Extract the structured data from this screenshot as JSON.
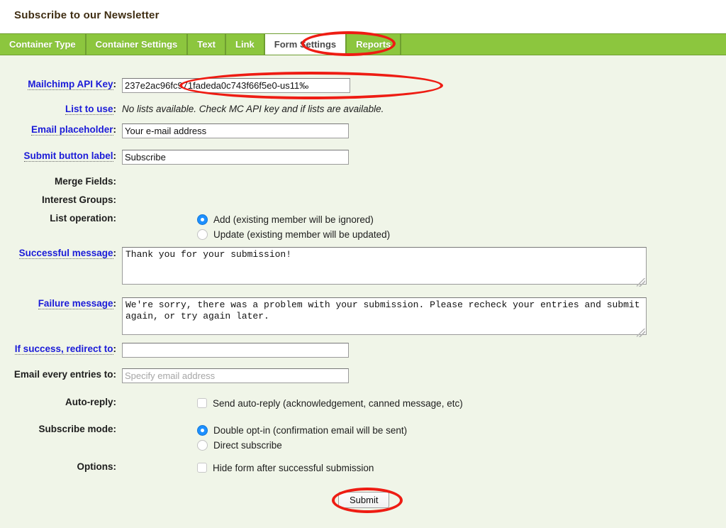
{
  "page": {
    "title": "Subscribe to our Newsletter",
    "background_color": "#f0f5e8",
    "tab_color": "#8cc63e",
    "annotation_color": "#ee1c13",
    "link_color": "#1b1bd8"
  },
  "tabs": [
    {
      "label": "Container Type",
      "active": false
    },
    {
      "label": "Container Settings",
      "active": false
    },
    {
      "label": "Text",
      "active": false
    },
    {
      "label": "Link",
      "active": false
    },
    {
      "label": "Form Settings",
      "active": true
    },
    {
      "label": "Reports",
      "active": false
    }
  ],
  "form": {
    "api_key": {
      "label": "Mailchimp API Key",
      "colon": ":",
      "value": "237e2ac96fc971fadeda0c743f66f5e0-us11‰"
    },
    "list_to_use": {
      "label": "List to use",
      "colon": ":",
      "note": "No lists available. Check MC API key and if lists are available."
    },
    "email_placeholder": {
      "label": "Email placeholder",
      "colon": ":",
      "value": "Your e-mail address"
    },
    "submit_button_label": {
      "label": "Submit button label",
      "colon": ":",
      "value": "Subscribe"
    },
    "merge_fields": {
      "label": "Merge Fields",
      "colon": ":"
    },
    "interest_groups": {
      "label": "Interest Groups",
      "colon": ":"
    },
    "list_operation": {
      "label": "List operation",
      "colon": ":",
      "options": [
        {
          "label": "Add (existing member will be ignored)",
          "selected": true
        },
        {
          "label": "Update (existing member will be updated)",
          "selected": false
        }
      ]
    },
    "successful_message": {
      "label": "Successful message",
      "colon": ":",
      "value": "Thank you for your submission!"
    },
    "failure_message": {
      "label": "Failure message",
      "colon": ":",
      "value": "We're sorry, there was a problem with your submission. Please recheck your entries and submit again, or try again later."
    },
    "redirect": {
      "label": "If success, redirect to",
      "colon": ":",
      "value": ""
    },
    "email_entries": {
      "label": "Email every entries to",
      "colon": ":",
      "value": "",
      "placeholder": "Specify email address"
    },
    "auto_reply": {
      "label": "Auto-reply",
      "colon": ":",
      "options": [
        {
          "label": "Send auto-reply (acknowledgement, canned message, etc)",
          "checked": false
        }
      ]
    },
    "subscribe_mode": {
      "label": "Subscribe mode",
      "colon": ":",
      "options": [
        {
          "label": "Double opt-in (confirmation email will be sent)",
          "selected": true
        },
        {
          "label": "Direct subscribe",
          "selected": false
        }
      ]
    },
    "options": {
      "label": "Options",
      "colon": ":",
      "options": [
        {
          "label": "Hide form after successful submission",
          "checked": false
        }
      ]
    },
    "submit_button": "Submit"
  }
}
